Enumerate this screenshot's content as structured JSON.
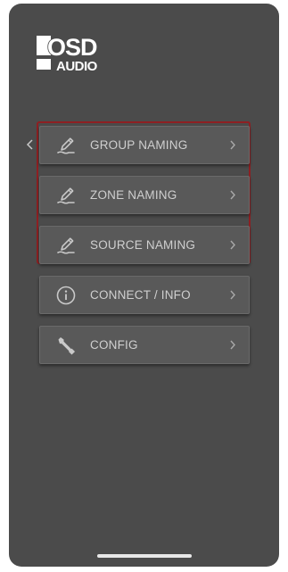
{
  "logo": {
    "line1": "OSD",
    "line2": "AUDIO"
  },
  "back": {
    "icon": "chevron-left-icon"
  },
  "menu": {
    "items": [
      {
        "label": "GROUP NAMING",
        "icon": "pencil-icon",
        "highlighted": true
      },
      {
        "label": "ZONE NAMING",
        "icon": "pencil-icon",
        "highlighted": true
      },
      {
        "label": "SOURCE NAMING",
        "icon": "pencil-icon",
        "highlighted": true
      },
      {
        "label": "CONNECT / INFO",
        "icon": "info-circle-icon",
        "highlighted": false
      },
      {
        "label": "CONFIG",
        "icon": "wrench-icon",
        "highlighted": false
      }
    ]
  },
  "colors": {
    "background": "#4b4b4b",
    "button": "#595959",
    "text": "#cfcfcf",
    "highlight_border": "#8e1f22"
  }
}
